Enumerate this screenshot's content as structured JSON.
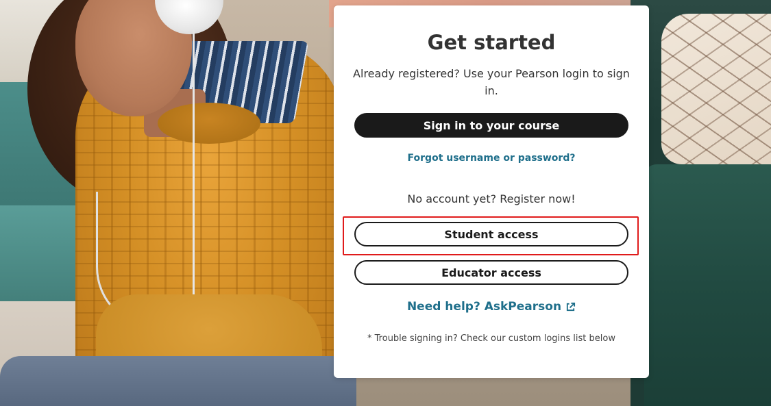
{
  "card": {
    "title": "Get started",
    "intro": "Already registered? Use your Pearson login to sign in.",
    "sign_in_label": "Sign in to your course",
    "forgot_label": "Forgot username or password?",
    "register_text": "No account yet? Register now!",
    "student_label": "Student access",
    "educator_label": "Educator access",
    "help_label": "Need help? AskPearson",
    "help_icon": "external-link-icon",
    "trouble_text": "* Trouble signing in? Check our custom logins list below"
  },
  "colors": {
    "primary_button": "#1a1a1a",
    "link": "#1f6f8b",
    "highlight": "#e01b1b"
  }
}
